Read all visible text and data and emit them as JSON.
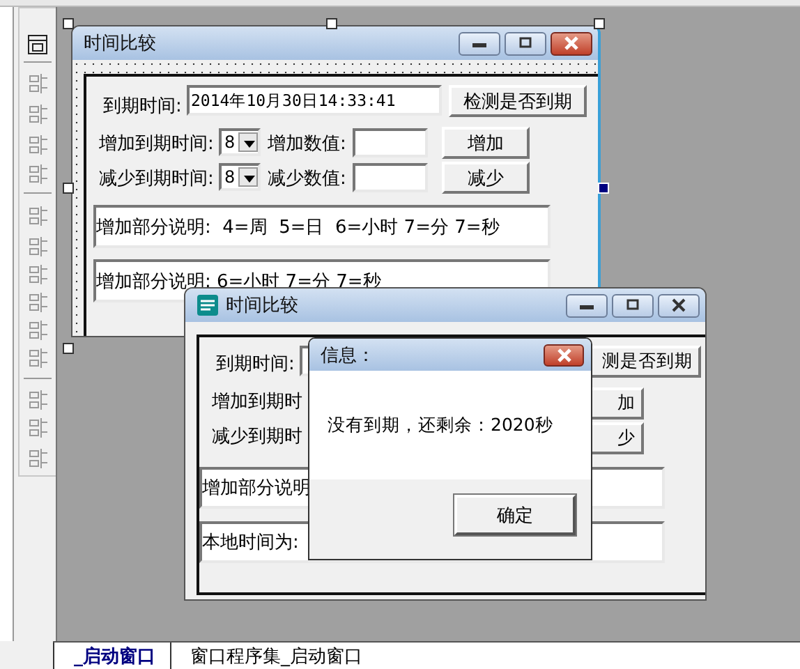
{
  "designer_form": {
    "title": "时间比较",
    "expiry_label": "到期时间:",
    "expiry_value": "2014年10月30日14:33:41",
    "check_button": "检测是否到期",
    "add_label": "增加到期时间:",
    "add_combo": "8",
    "add_amount_label": "增加数值:",
    "add_button": "增加",
    "sub_label": "减少到期时间:",
    "sub_combo": "8",
    "sub_amount_label": "减少数值:",
    "sub_button": "减少",
    "note_1": "增加部分说明:  4=周  5=日  6=小时 7=分 7=秒",
    "note_2": "增加部分说明: 6=小时 7=分 7=秒"
  },
  "selection_handles": [
    {
      "selected": false
    },
    {
      "selected": false
    },
    {
      "selected": false
    },
    {
      "selected": false
    },
    {
      "selected": true
    },
    {
      "selected": false
    }
  ],
  "running_form": {
    "title": "时间比较",
    "expiry_label": "到期时间:",
    "check_button": "测是否到期",
    "add_label": "增加到期时",
    "sub_label": "减少到期时",
    "add_button": "加",
    "sub_button": "少",
    "note": "增加部分说明",
    "local_time": "本地时间为:"
  },
  "message_box": {
    "title": "信息：",
    "message": "没有到期，还剩余：2020秒",
    "ok_button": "确定"
  },
  "tabs": [
    {
      "label": "_启动窗口",
      "selected": true
    },
    {
      "label": "窗口程序集_启动窗口",
      "selected": false
    }
  ]
}
